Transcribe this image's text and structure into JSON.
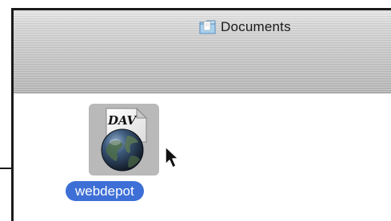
{
  "window": {
    "title": "Documents",
    "title_icon": "folder-icon"
  },
  "items": [
    {
      "label": "webdepot",
      "icon": "dav-globe-document-icon",
      "icon_text": "DAV",
      "selected": true
    }
  ],
  "cursor": "arrow-cursor-icon",
  "colors": {
    "selection": "#3d6fd6",
    "titlebar": "#c8c8c8",
    "tile": "#b9b9b9"
  }
}
